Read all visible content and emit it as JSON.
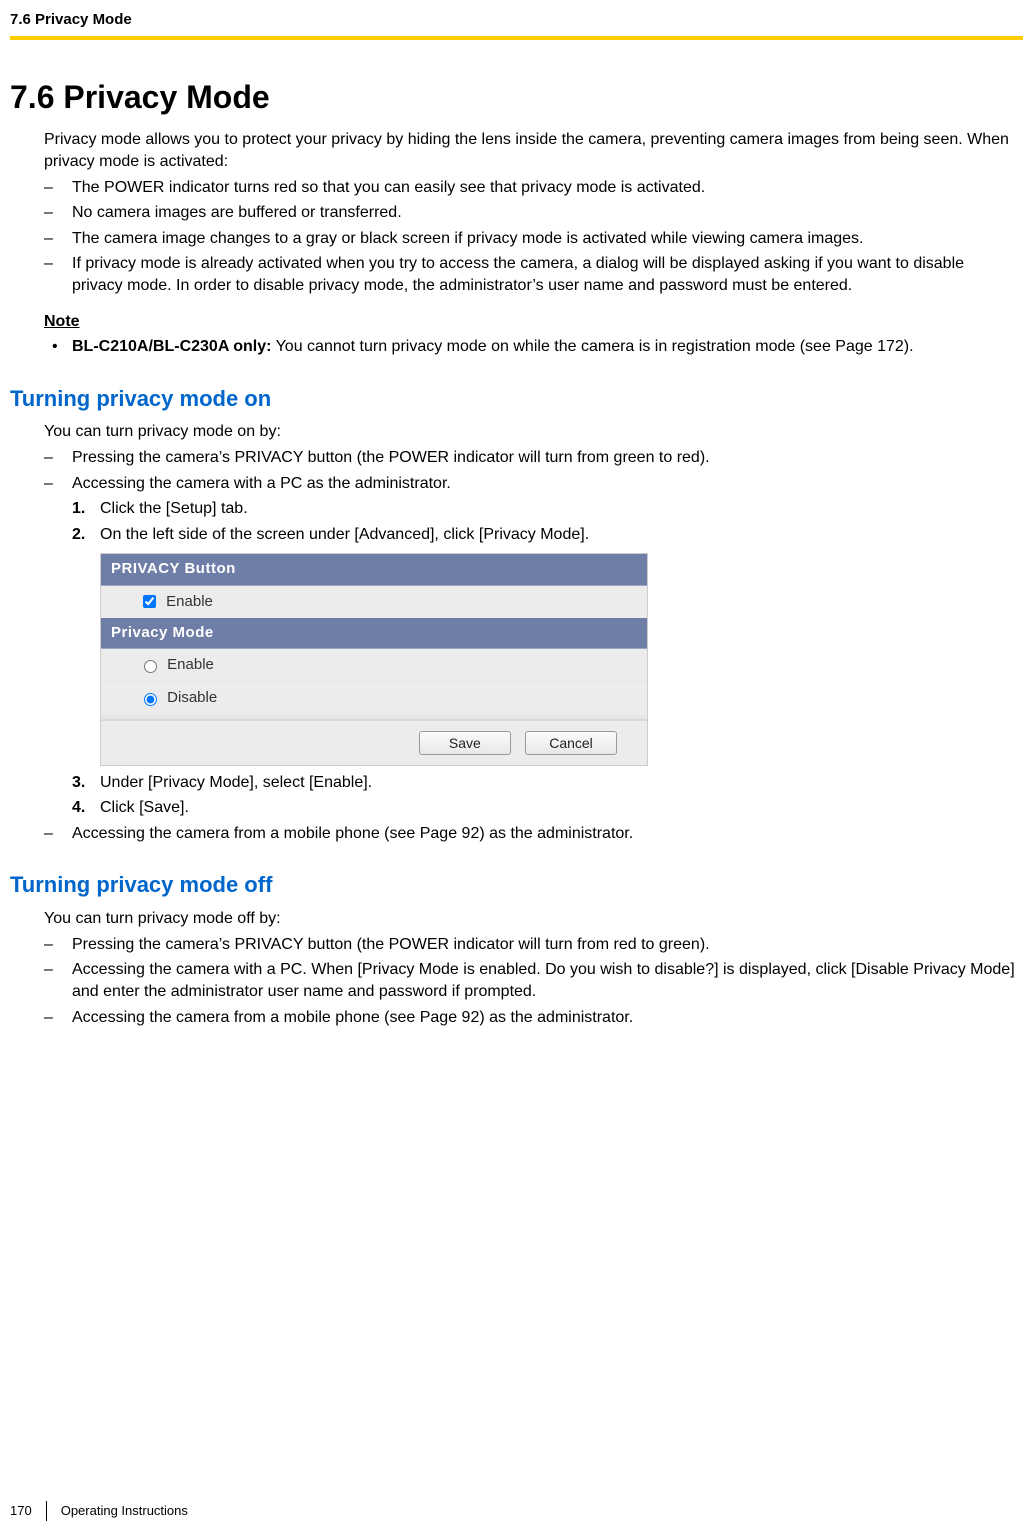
{
  "header": {
    "running_head": "7.6 Privacy Mode"
  },
  "section": {
    "title": "7.6  Privacy Mode",
    "intro": "Privacy mode allows you to protect your privacy by hiding the lens inside the camera, preventing camera images from being seen. When privacy mode is activated:",
    "bullets": [
      "The POWER indicator turns red so that you can easily see that privacy mode is activated.",
      "No camera images are buffered or transferred.",
      "The camera image changes to a gray or black screen if privacy mode is activated while viewing camera images.",
      "If privacy mode is already activated when you try to access the camera, a dialog will be displayed asking if you want to disable privacy mode. In order to disable privacy mode, the administrator’s user name and password must be entered."
    ],
    "note_label": "Note",
    "note_strong": "BL-C210A/BL-C230A only:",
    "note_text": " You cannot turn privacy mode on while the camera is in registration mode (see Page 172)."
  },
  "on": {
    "heading": "Turning privacy mode on",
    "intro": "You can turn privacy mode on by:",
    "b1": "Pressing the camera’s PRIVACY button (the POWER indicator will turn from green to red).",
    "b2": "Accessing the camera with a PC as the administrator.",
    "steps": [
      "Click the [Setup] tab.",
      "On the left side of the screen under [Advanced], click [Privacy Mode].",
      "Under [Privacy Mode], select [Enable].",
      "Click [Save]."
    ],
    "b3": "Accessing the camera from a mobile phone (see Page 92) as the administrator."
  },
  "ui": {
    "panel1_title": "PRIVACY Button",
    "panel1_opt_enable": "Enable",
    "panel1_checked": true,
    "panel2_title": "Privacy Mode",
    "panel2_opt_enable": "Enable",
    "panel2_opt_disable": "Disable",
    "panel2_selected": "disable",
    "btn_save": "Save",
    "btn_cancel": "Cancel"
  },
  "off": {
    "heading": "Turning privacy mode off",
    "intro": "You can turn privacy mode off by:",
    "bullets": [
      "Pressing the camera’s PRIVACY button (the POWER indicator will turn from red to green).",
      "Accessing the camera with a PC. When [Privacy Mode is enabled. Do you wish to disable?] is displayed, click [Disable Privacy Mode] and enter the administrator user name and password if prompted.",
      "Accessing the camera from a mobile phone (see Page 92) as the administrator."
    ]
  },
  "footer": {
    "page_number": "170",
    "doc_title": "Operating Instructions"
  }
}
